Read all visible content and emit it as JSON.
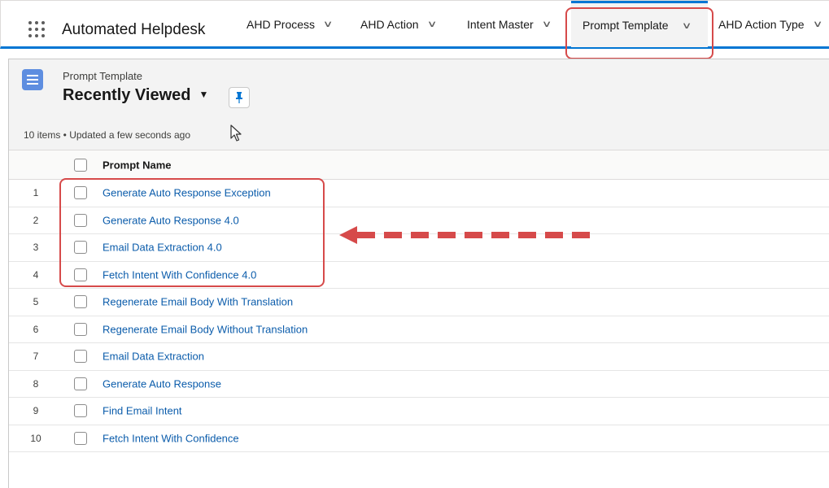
{
  "app": {
    "name": "Automated Helpdesk"
  },
  "nav": {
    "items": [
      {
        "label": "AHD Process"
      },
      {
        "label": "AHD Action"
      },
      {
        "label": "Intent Master"
      },
      {
        "label": "Prompt Template"
      },
      {
        "label": "AHD Action Type"
      }
    ],
    "active_index": 3
  },
  "list_view": {
    "object_label": "Prompt Template",
    "title": "Recently Viewed",
    "meta": "10 items • Updated a few seconds ago"
  },
  "table": {
    "columns": [
      "Prompt Name"
    ],
    "rows": [
      {
        "num": "1",
        "name": "Generate Auto Response Exception"
      },
      {
        "num": "2",
        "name": "Generate Auto Response 4.0"
      },
      {
        "num": "3",
        "name": "Email Data Extraction 4.0"
      },
      {
        "num": "4",
        "name": "Fetch Intent With Confidence 4.0"
      },
      {
        "num": "5",
        "name": "Regenerate Email Body With Translation"
      },
      {
        "num": "6",
        "name": "Regenerate Email Body Without Translation"
      },
      {
        "num": "7",
        "name": "Email Data Extraction"
      },
      {
        "num": "8",
        "name": "Generate Auto Response"
      },
      {
        "num": "9",
        "name": "Find Email Intent"
      },
      {
        "num": "10",
        "name": "Fetch Intent With Confidence"
      }
    ]
  },
  "annotation": {
    "color": "#d64a4a"
  },
  "colors": {
    "brand": "#0176d3",
    "link": "#0b5cab",
    "object_icon": "#5e8ee0"
  }
}
